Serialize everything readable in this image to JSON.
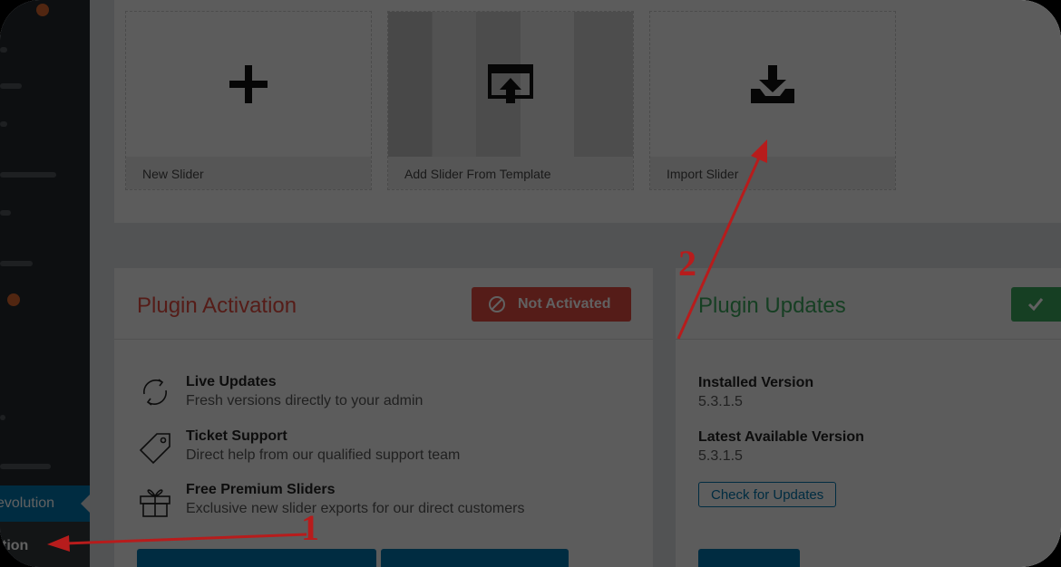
{
  "sidebar": {
    "active_item_label": "evolution",
    "sub_item_label": "tion"
  },
  "tiles": [
    {
      "label": "New Slider",
      "icon": "plus-icon"
    },
    {
      "label": "Add Slider From Template",
      "icon": "template-upload-icon"
    },
    {
      "label": "Import Slider",
      "icon": "import-download-icon"
    }
  ],
  "activation": {
    "title": "Plugin Activation",
    "title_color": "#e04a3f",
    "badge_label": "Not Activated",
    "badge_color": "#e04a3f",
    "features": [
      {
        "title": "Live Updates",
        "desc": "Fresh versions directly to your admin",
        "icon": "refresh-icon"
      },
      {
        "title": "Ticket Support",
        "desc": "Direct help from our qualified support team",
        "icon": "tag-icon"
      },
      {
        "title": "Free Premium Sliders",
        "desc": "Exclusive new slider exports for our direct customers",
        "icon": "gift-icon"
      }
    ]
  },
  "updates": {
    "title": "Plugin Updates",
    "title_color": "#3ba55c",
    "badge_color": "#3ba55c",
    "installed_label": "Installed Version",
    "installed_value": "5.3.1.5",
    "latest_label": "Latest Available Version",
    "latest_value": "5.3.1.5",
    "check_button": "Check for Updates"
  },
  "annotations": {
    "marker_1": "1",
    "marker_2": "2",
    "arrow_color": "#b71c1c"
  }
}
